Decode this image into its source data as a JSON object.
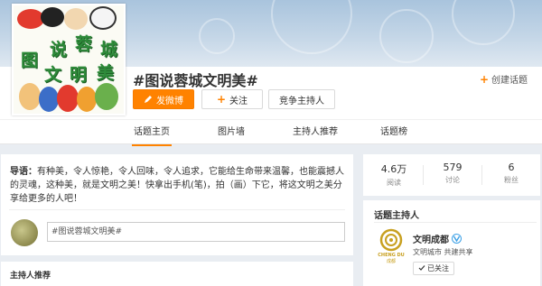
{
  "topic": {
    "title": "#图说蓉城文明美#",
    "create_topic": "创建话题",
    "cover_chars": [
      "说",
      "蓉",
      "城",
      "图",
      "文",
      "明",
      "美"
    ]
  },
  "actions": {
    "post": "发微博",
    "follow": "关注",
    "compete_host": "竞争主持人"
  },
  "tabs": [
    "话题主页",
    "图片墙",
    "主持人推荐",
    "话题榜"
  ],
  "intro": {
    "label": "导语：",
    "text": "有种美，令人惊艳，令人回味，令人追求，它能给生命带来温馨，也能震撼人的灵魂，这种美，就是文明之美！快拿出手机(笔)，拍（画）下它，将这文明之美分享给更多的人吧！"
  },
  "compose": {
    "text": "#图说蓉城文明美#"
  },
  "host_recommend": {
    "title": "主持人推荐"
  },
  "stats": [
    {
      "value": "4.6万",
      "label": "阅读"
    },
    {
      "value": "579",
      "label": "讨论"
    },
    {
      "value": "6",
      "label": "粉丝"
    }
  ],
  "host": {
    "section_title": "话题主持人",
    "name": "文明成都",
    "subtitle": "文明城市 共建共享",
    "followed_label": "已关注",
    "logo_text": "CHENG DU",
    "logo_sub": "成都"
  },
  "colors": {
    "accent": "#ff8200",
    "verified": "#3ca0e6",
    "logo_gold": "#c8a020"
  }
}
